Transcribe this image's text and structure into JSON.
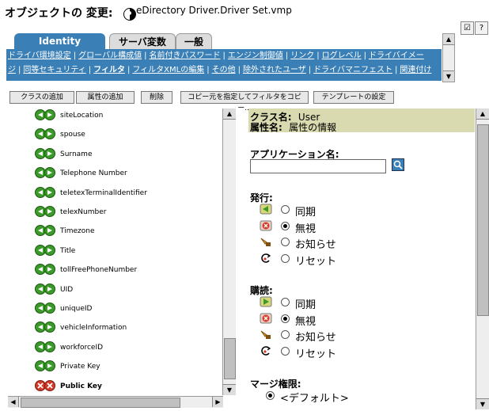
{
  "header": {
    "title": "オブジェクトの 変更:",
    "driver_name": "eDirectory Driver.Driver Set.vmp",
    "help_label": "?",
    "tasks_label": "☑"
  },
  "tabs": [
    {
      "label": "Identity Manager",
      "active": true
    },
    {
      "label": "サーバ変数",
      "active": false
    },
    {
      "label": "一般",
      "active": false
    }
  ],
  "links_row1": [
    "ドライバ環境設定",
    "グローバル構成値",
    "名前付きパスワード",
    "エンジン制御値",
    "リンク",
    "ログレベル",
    "ドライバイメー"
  ],
  "links_row2": [
    "ジ",
    "同等セキュリティ",
    "フィルタ",
    "フィルタXMLの編集",
    "その他",
    "除外されたユーザ",
    "ドライバマニフェスト",
    "関連付け"
  ],
  "toolbar": {
    "add_class": "クラスの追加",
    "add_attr": "属性の追加",
    "delete": "削除",
    "copy_filter": "コピー元を指定してフィルタをコピー...",
    "template": "テンプレートの設定"
  },
  "attributes": [
    {
      "name": "siteLocation",
      "bold": false,
      "type": "sync"
    },
    {
      "name": "spouse",
      "bold": false,
      "type": "sync"
    },
    {
      "name": "Surname",
      "bold": false,
      "type": "sync"
    },
    {
      "name": "Telephone Number",
      "bold": false,
      "type": "sync"
    },
    {
      "name": "teletexTerminalIdentifier",
      "bold": false,
      "type": "sync"
    },
    {
      "name": "telexNumber",
      "bold": false,
      "type": "sync"
    },
    {
      "name": "Timezone",
      "bold": false,
      "type": "sync"
    },
    {
      "name": "Title",
      "bold": false,
      "type": "sync"
    },
    {
      "name": "tollFreePhoneNumber",
      "bold": false,
      "type": "sync"
    },
    {
      "name": "UID",
      "bold": false,
      "type": "sync"
    },
    {
      "name": "uniqueID",
      "bold": false,
      "type": "sync"
    },
    {
      "name": "vehicleInformation",
      "bold": false,
      "type": "sync"
    },
    {
      "name": "workforceID",
      "bold": false,
      "type": "sync"
    },
    {
      "name": "Private Key",
      "bold": false,
      "type": "sync"
    },
    {
      "name": "Public Key",
      "bold": true,
      "type": "ignore"
    }
  ],
  "details": {
    "class_label": "クラス名:",
    "class_value": "User",
    "attr_label": "属性名:",
    "attr_value": "属性の情報",
    "app_name_label": "アプリケーション名:",
    "publish_label": "発行:",
    "subscribe_label": "購読:",
    "merge_label": "マージ権限:",
    "merge_default": "<デフォルト>",
    "publish_options": [
      {
        "label": "同期",
        "selected": false,
        "icon": "sync-icon"
      },
      {
        "label": "無視",
        "selected": true,
        "icon": "ignore-icon"
      },
      {
        "label": "お知らせ",
        "selected": false,
        "icon": "notify-icon"
      },
      {
        "label": "リセット",
        "selected": false,
        "icon": "reset-icon"
      }
    ],
    "subscribe_options": [
      {
        "label": "同期",
        "selected": false,
        "icon": "sync-icon"
      },
      {
        "label": "無視",
        "selected": true,
        "icon": "ignore-icon"
      },
      {
        "label": "お知らせ",
        "selected": false,
        "icon": "notify-icon"
      },
      {
        "label": "リセット",
        "selected": false,
        "icon": "reset-icon"
      }
    ]
  },
  "colors": {
    "tab_blue": "#3a7fb5",
    "class_box": "#dadab0",
    "sync_green": "#3c9a2a",
    "ignore_red": "#d23a2a"
  }
}
